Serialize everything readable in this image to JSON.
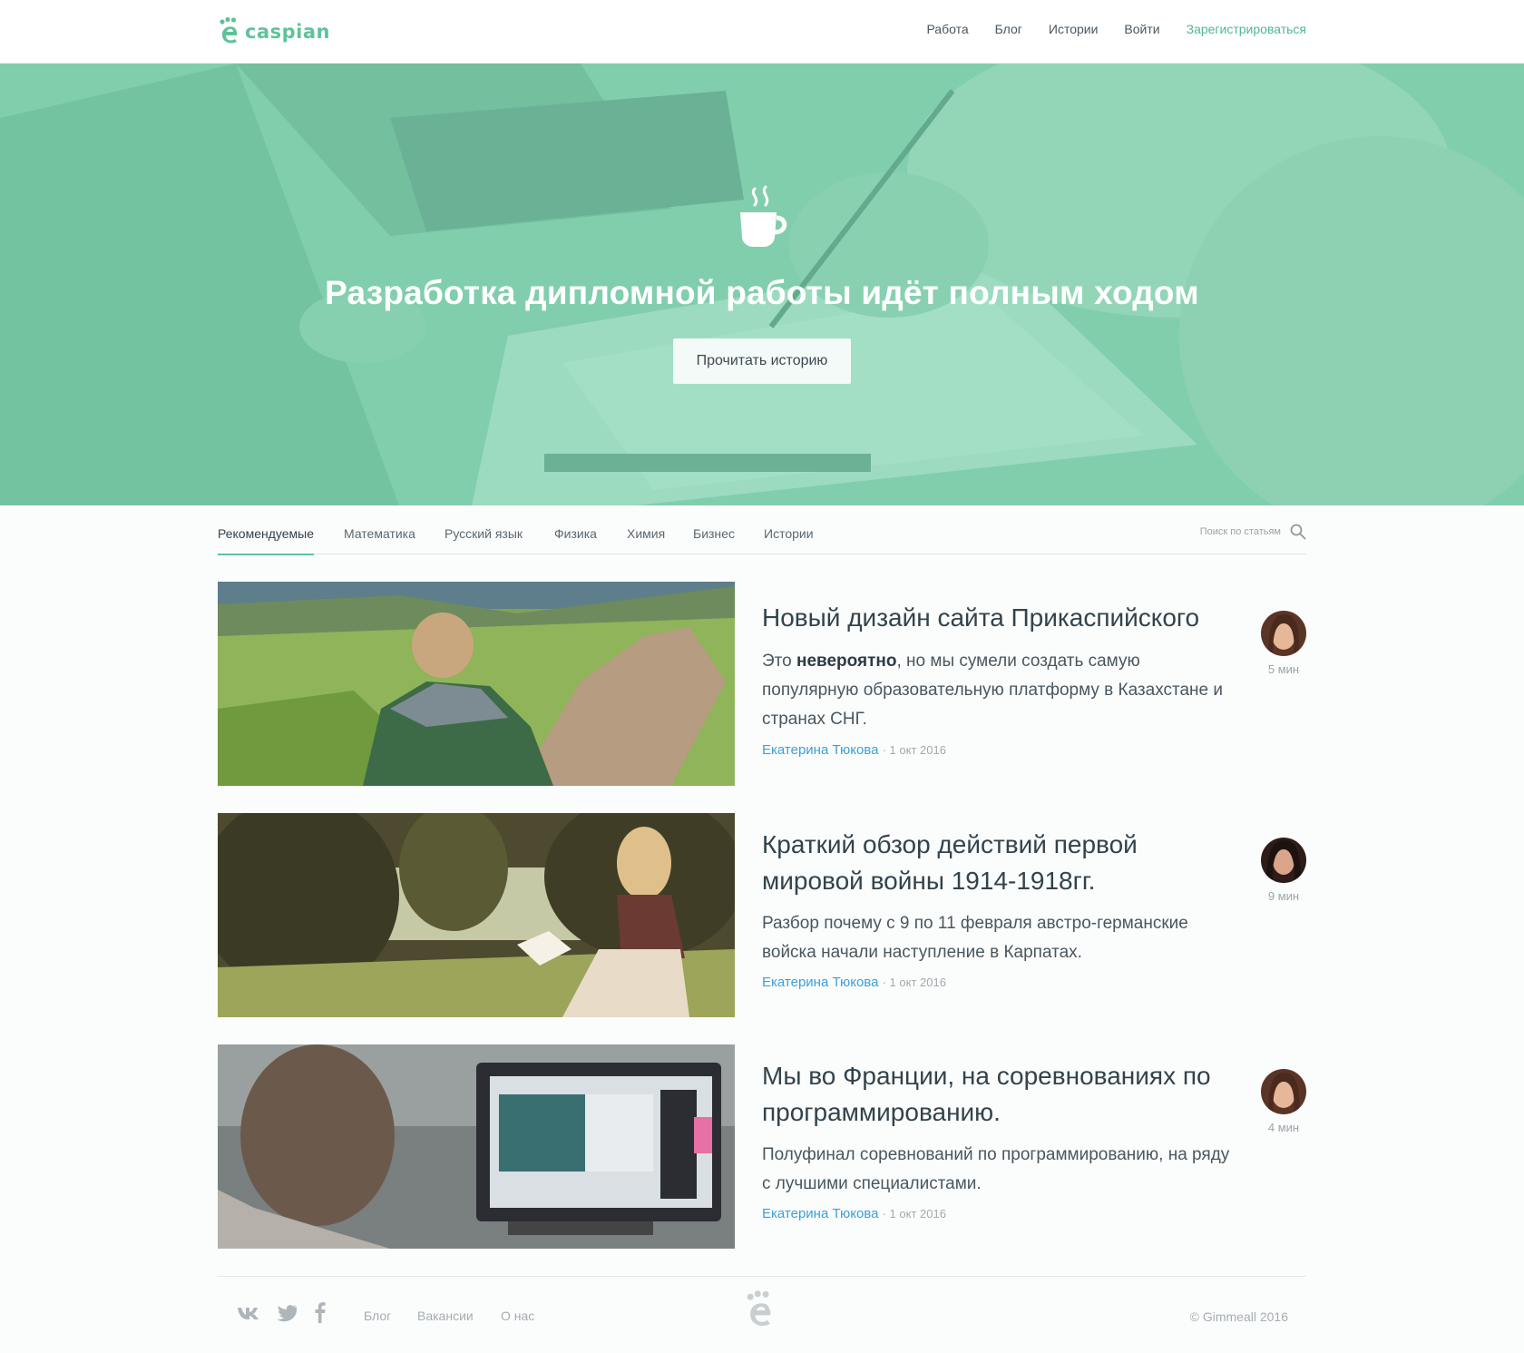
{
  "brand": {
    "name": "caspian",
    "logo_icon": "paw-e-logo-icon",
    "accent": "#5fc39a"
  },
  "nav": {
    "items": [
      "Работа",
      "Блог",
      "Истории",
      "Войти"
    ],
    "signup": "Зарегистрироваться"
  },
  "hero": {
    "icon": "coffee-cup-icon",
    "title": "Разработка дипломной работы идёт полным ходом",
    "button": "Прочитать историю"
  },
  "tabs": {
    "items": [
      "Рекомендуемые",
      "Математика",
      "Русский язык",
      "Физика",
      "Химия",
      "Бизнес",
      "Истории"
    ],
    "active": "Рекомендуемые",
    "search_placeholder": "Поиск по статьям"
  },
  "articles": [
    {
      "title": "Новый дизайн сайта Прикаспийского",
      "excerpt_pre": "Это ",
      "excerpt_bold": "невероятно",
      "excerpt_post": ", но мы сумели создать самую популярную образовательную платформу в Казахстане и странах СНГ.",
      "author": "Екатерина Тюкова",
      "date": "· 1 окт 2016",
      "readtime": "5 мин"
    },
    {
      "title": "Краткий обзор действий первой мировой войны 1914-1918гг.",
      "excerpt": "Разбор почему с 9 по 11 февраля австро-германские войска начали наступление в Карпатах.",
      "author": "Екатерина Тюкова",
      "date": "· 1 окт 2016",
      "readtime": "9 мин"
    },
    {
      "title": "Мы во Франции, на соревнованиях по программированию.",
      "excerpt": "Полуфинал соревнований по программированию, на ряду с лучшими специалистами.",
      "author": "Екатерина Тюкова",
      "date": "· 1 окт 2016",
      "readtime": "4 мин"
    }
  ],
  "footer": {
    "social": [
      "vk-icon",
      "twitter-icon",
      "facebook-icon"
    ],
    "links": [
      "Блог",
      "Вакансии",
      "О нас"
    ],
    "copyright": "© Gimmeall 2016"
  }
}
